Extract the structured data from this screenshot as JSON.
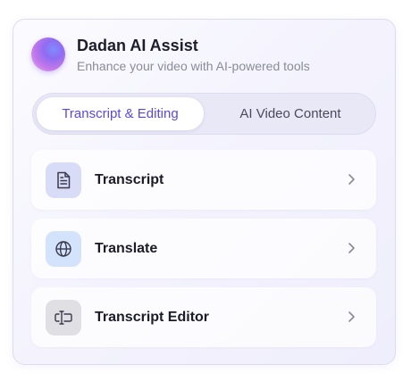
{
  "header": {
    "title": "Dadan AI Assist",
    "subtitle": "Enhance your video with AI-powered tools",
    "logo_icon": "gradient-orb-icon"
  },
  "tabs": [
    {
      "label": "Transcript & Editing",
      "active": true
    },
    {
      "label": "AI Video Content",
      "active": false
    }
  ],
  "tools": [
    {
      "label": "Transcript",
      "icon": "document-icon"
    },
    {
      "label": "Translate",
      "icon": "globe-icon"
    },
    {
      "label": "Transcript Editor",
      "icon": "text-cursor-icon"
    }
  ],
  "colors": {
    "accent": "#5a49e0",
    "panel_background": "#f3f2fd",
    "tab_track": "#e9e8f7"
  }
}
